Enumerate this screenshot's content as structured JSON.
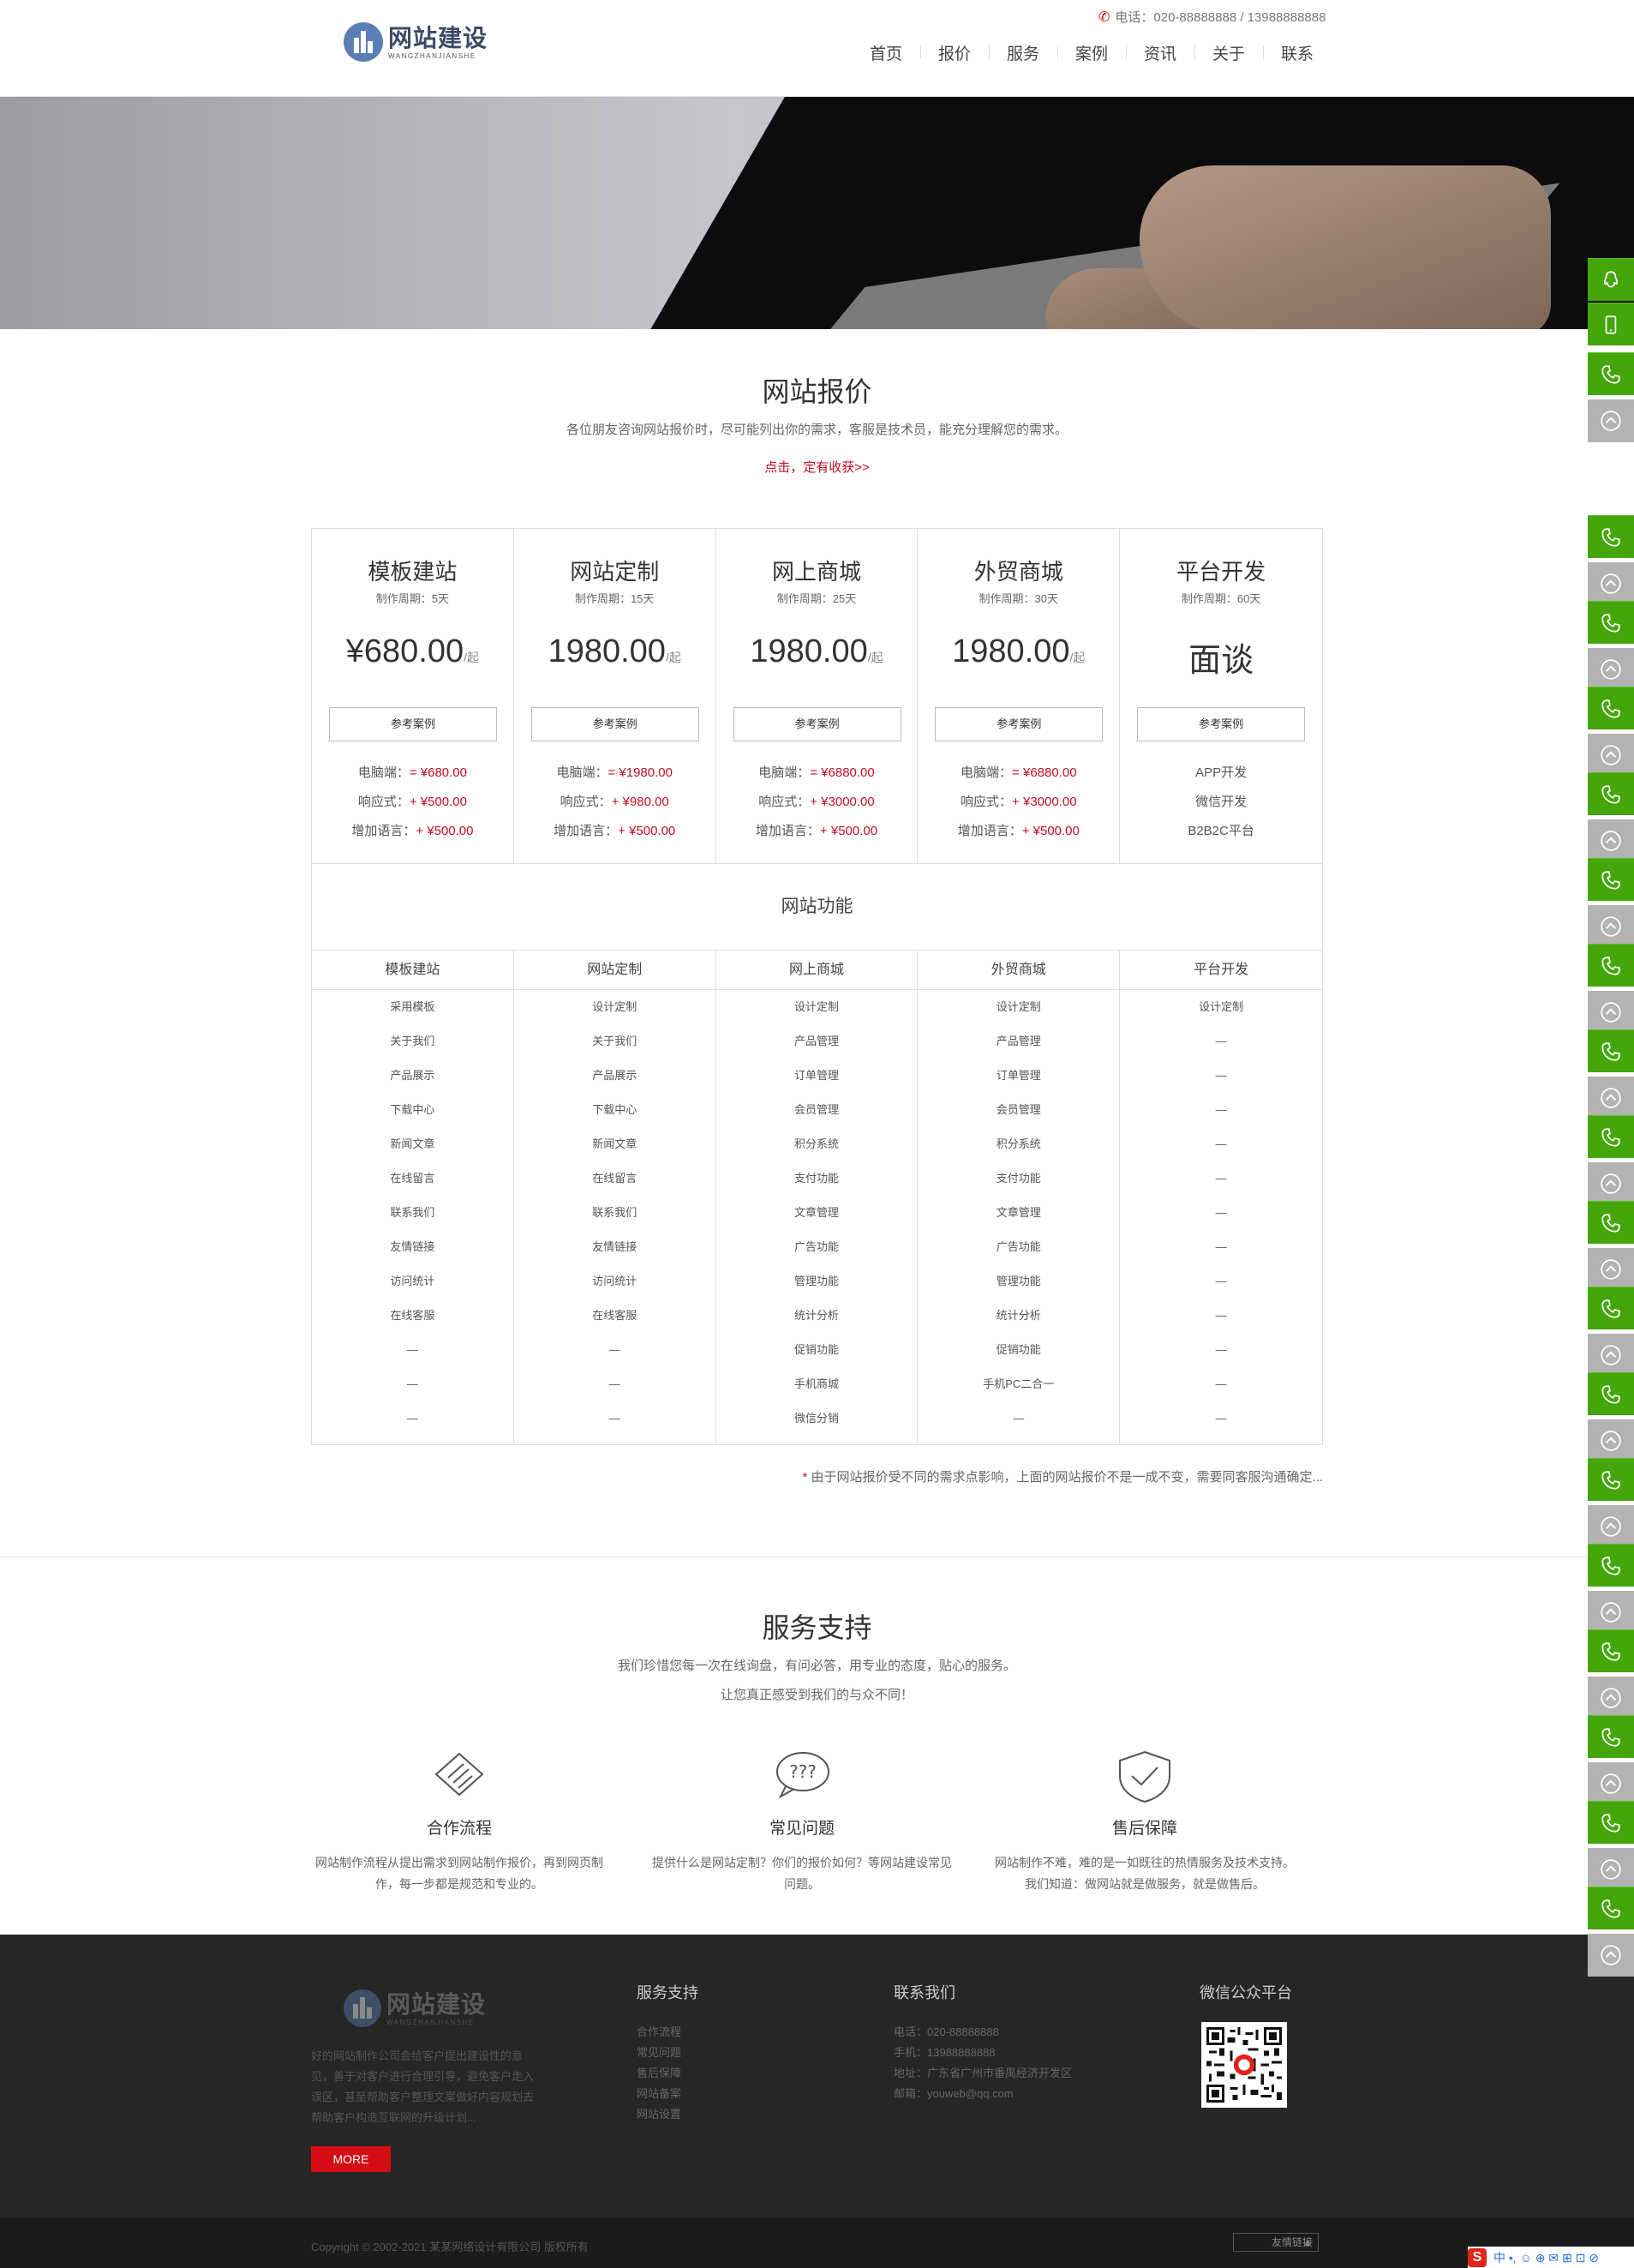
{
  "header": {
    "logo_cn": "网站建设",
    "logo_en": "WANGZHANJIANSHE",
    "phone": "电话：020-88888888 / 13988888888",
    "nav": [
      "首页",
      "报价",
      "服务",
      "案例",
      "资讯",
      "关于",
      "联系"
    ]
  },
  "pricing": {
    "title": "网站报价",
    "subtitle": "各位朋友咨询网站报价时，尽可能列出你的需求，客服是技术员，能充分理解您的需求。",
    "link": "点击，定有收获>>",
    "plans": [
      {
        "name": "模板建站",
        "period": "制作周期：5天",
        "price": "¥680.00",
        "unit": "/起",
        "button": "参考案例",
        "features": [
          {
            "label": "电脑端：",
            "value": "= ¥680.00"
          },
          {
            "label": "响应式：",
            "value": "+ ¥500.00"
          },
          {
            "label": "增加语言：",
            "value": "+ ¥500.00"
          }
        ]
      },
      {
        "name": "网站定制",
        "period": "制作周期：15天",
        "price": "1980.00",
        "unit": "/起",
        "button": "参考案例",
        "features": [
          {
            "label": "电脑端：",
            "value": "= ¥1980.00"
          },
          {
            "label": "响应式：",
            "value": "+ ¥980.00"
          },
          {
            "label": "增加语言：",
            "value": "+ ¥500.00"
          }
        ]
      },
      {
        "name": "网上商城",
        "period": "制作周期：25天",
        "price": "1980.00",
        "unit": "/起",
        "button": "参考案例",
        "features": [
          {
            "label": "电脑端：",
            "value": "= ¥6880.00"
          },
          {
            "label": "响应式：",
            "value": "+ ¥3000.00"
          },
          {
            "label": "增加语言：",
            "value": "+ ¥500.00"
          }
        ]
      },
      {
        "name": "外贸商城",
        "period": "制作周期：30天",
        "price": "1980.00",
        "unit": "/起",
        "button": "参考案例",
        "features": [
          {
            "label": "电脑端：",
            "value": "= ¥6880.00"
          },
          {
            "label": "响应式：",
            "value": "+ ¥3000.00"
          },
          {
            "label": "增加语言：",
            "value": "+ ¥500.00"
          }
        ]
      },
      {
        "name": "平台开发",
        "period": "制作周期：60天",
        "price": "面谈",
        "unit": "",
        "button": "参考案例",
        "features": [
          {
            "label": "APP开发",
            "value": ""
          },
          {
            "label": "微信开发",
            "value": ""
          },
          {
            "label": "B2B2C平台",
            "value": ""
          }
        ]
      }
    ],
    "features_title": "网站功能",
    "feature_columns": [
      {
        "head": "模板建站",
        "items": [
          "采用模板",
          "关于我们",
          "产品展示",
          "下载中心",
          "新闻文章",
          "在线留言",
          "联系我们",
          "友情链接",
          "访问统计",
          "在线客服",
          "—",
          "—",
          "—"
        ]
      },
      {
        "head": "网站定制",
        "items": [
          "设计定制",
          "关于我们",
          "产品展示",
          "下载中心",
          "新闻文章",
          "在线留言",
          "联系我们",
          "友情链接",
          "访问统计",
          "在线客服",
          "—",
          "—",
          "—"
        ]
      },
      {
        "head": "网上商城",
        "items": [
          "设计定制",
          "产品管理",
          "订单管理",
          "会员管理",
          "积分系统",
          "支付功能",
          "文章管理",
          "广告功能",
          "管理功能",
          "统计分析",
          "促销功能",
          "手机商城",
          "微信分销"
        ]
      },
      {
        "head": "外贸商城",
        "items": [
          "设计定制",
          "产品管理",
          "订单管理",
          "会员管理",
          "积分系统",
          "支付功能",
          "文章管理",
          "广告功能",
          "管理功能",
          "统计分析",
          "促销功能",
          "手机PC二合一",
          "—"
        ]
      },
      {
        "head": "平台开发",
        "items": [
          "设计定制",
          "—",
          "—",
          "—",
          "—",
          "—",
          "—",
          "—",
          "—",
          "—",
          "—",
          "—",
          "—"
        ]
      }
    ],
    "note_star": "*",
    "note": " 由于网站报价受不同的需求点影响，上面的网站报价不是一成不变，需要同客服沟通确定..."
  },
  "service": {
    "title": "服务支持",
    "sub1": "我们珍惜您每一次在线询盘，有问必答，用专业的态度，贴心的服务。",
    "sub2": "让您真正感受到我们的与众不同！",
    "items": [
      {
        "icon": "handshake-icon",
        "title": "合作流程",
        "desc": "网站制作流程从提出需求到网站制作报价，再到网页制作，每一步都是规范和专业的。"
      },
      {
        "icon": "question-bubble-icon",
        "title": "常见问题",
        "desc": "提供什么是网站定制？你们的报价如何？等网站建设常见问题。"
      },
      {
        "icon": "shield-check-icon",
        "title": "售后保障",
        "desc": "网站制作不难，难的是一如既往的热情服务及技术支持。我们知道：做网站就是做服务，就是做售后。"
      }
    ]
  },
  "footer": {
    "logo_cn": "网站建设",
    "logo_en": "WANGZHANJIANSHE",
    "desc": "好的网站制作公司会给客户提出建设性的意见，善于对客户进行合理引导，避免客户走入误区，甚至帮助客户整理文案做好内容规划去帮助客户构造互联网的升级计划...",
    "more": "MORE",
    "col1": {
      "title": "服务支持",
      "links": [
        "合作流程",
        "常见问题",
        "售后保障",
        "网站备案",
        "网站设置"
      ]
    },
    "col2": {
      "title": "联系我们",
      "lines": [
        "电话：020-88888888",
        "手机：13988888888",
        "地址：广东省广州市番禺经济开发区",
        "邮箱：youweb@qq.com"
      ]
    },
    "col3": {
      "title": "微信公众平台"
    },
    "copyright": "Copyright © 2002-2021 某某网络设计有限公司 版权所有",
    "friend_link": "友情链接",
    "friend_arrow": "▲"
  },
  "ime": {
    "logo": "S",
    "icons": "中 •, ☺ ⊕ ✉ ⊞ ⊡ ⊘"
  },
  "colors": {
    "accent_red": "#c30d23",
    "side_green": "#44a60b",
    "side_gray": "#b3b3b3",
    "footer_bg": "#262626"
  }
}
